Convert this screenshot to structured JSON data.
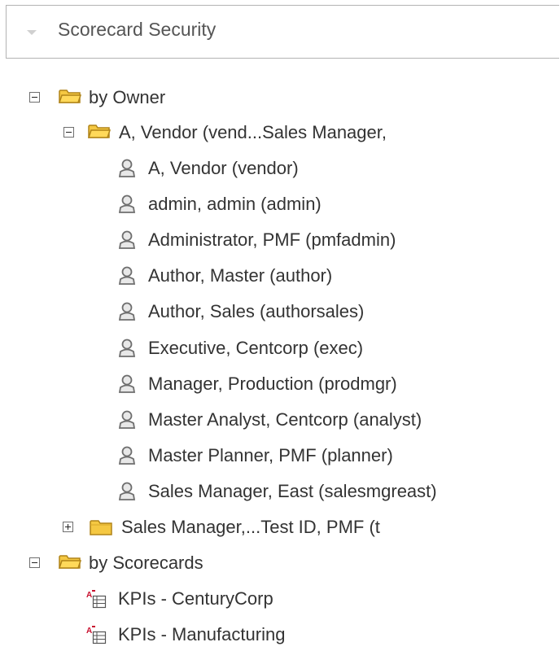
{
  "panel": {
    "title": "Scorecard Security"
  },
  "tree": {
    "by_owner": {
      "label": "by Owner",
      "children": {
        "vendor_group": {
          "label": "A, Vendor (vend...Sales Manager,",
          "users": [
            "A, Vendor (vendor)",
            "admin, admin (admin)",
            "Administrator, PMF (pmfadmin)",
            "Author, Master (author)",
            "Author, Sales (authorsales)",
            "Executive, Centcorp (exec)",
            "Manager, Production (prodmgr)",
            "Master Analyst, Centcorp (analyst)",
            "Master Planner, PMF (planner)",
            "Sales Manager, East (salesmgreast)"
          ]
        },
        "sales_group": {
          "label": "Sales Manager,...Test ID, PMF (t"
        }
      }
    },
    "by_scorecards": {
      "label": "by Scorecards",
      "items": [
        "KPIs - CenturyCorp",
        "KPIs - Manufacturing"
      ]
    }
  },
  "icons": {
    "folder": "folder-icon",
    "folder_open": "folder-open-icon",
    "user": "user-icon",
    "scorecard": "scorecard-icon",
    "expand": "expand-icon",
    "collapse": "collapse-icon"
  },
  "colors": {
    "folder_fill": "#f5c842",
    "folder_stroke": "#b08418",
    "user_icon": "#6e6e6e",
    "scorecard_red": "#c8102e",
    "text": "#333333",
    "border": "#b3b3b3"
  }
}
